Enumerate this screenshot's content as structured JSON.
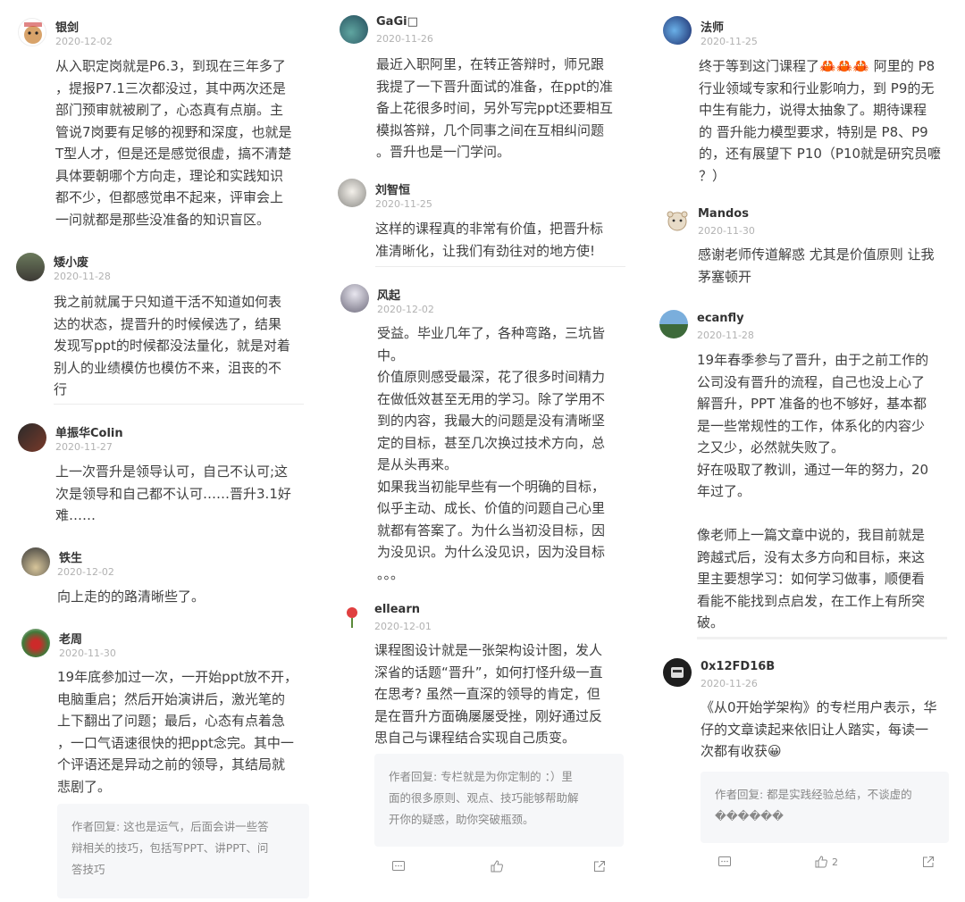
{
  "col1": [
    {
      "name": "银剑",
      "date": "2020-12-02",
      "text": "从入职定岗就是P6.3，到现在三年多了\n，提报P7.1三次都没过，其中两次还是\n部门预审就被刷了，心态真有点崩。主\n管说7岗要有足够的视野和深度，也就是\nT型人才，但是还是感觉很虚，搞不清楚\n具体要朝哪个方向走，理论和实践知识\n都不少，但都感觉串不起来，评审会上\n一问就都是那些没准备的知识盲区。"
    },
    {
      "name": "矮小废",
      "date": "2020-11-28",
      "text": "我之前就属于只知道干活不知道如何表\n达的状态，提晋升的时候候选了，结果\n发现写ppt的时候都没法量化，就是对着\n别人的业绩模仿也模仿不来，沮丧的不\n行"
    },
    {
      "name": "单振华Colin",
      "date": "2020-11-27",
      "text": "上一次晋升是领导认可，自己不认可;这\n次是领导和自己都不认可……晋升3.1好\n难……"
    },
    {
      "name": "铁生",
      "date": "2020-12-02",
      "text": "向上走的的路清晰些了。"
    },
    {
      "name": "老周",
      "date": "2020-11-30",
      "text": "19年底参加过一次，一开始ppt放不开，\n电脑重启；然后开始演讲后，激光笔的\n上下翻出了问题；最后，心态有点着急\n，一口气语速很快的把ppt念完。其中一\n个评语还是异动之前的领导，其结局就\n悲剧了。",
      "reply": "作者回复: 这也是运气，后面会讲一些答\n辩相关的技巧，包括写PPT、讲PPT、问\n答技巧"
    }
  ],
  "col2": [
    {
      "name": "GaGi□",
      "date": "2020-11-26",
      "text": "最近入职阿里，在转正答辩时，师兄跟\n我提了一下晋升面试的准备，在ppt的准\n备上花很多时间，另外写完ppt还要相互\n模拟答辩，几个同事之间在互相纠问题\n。晋升也是一门学问。"
    },
    {
      "name": "刘智恒",
      "date": "2020-11-25",
      "text": "这样的课程真的非常有价值，把晋升标\n准清晰化，让我们有劲往对的地方使!"
    },
    {
      "name": "风起",
      "date": "2020-12-02",
      "text": "受益。毕业几年了，各种弯路，三坑皆\n中。\n价值原则感受最深，花了很多时间精力\n在做低效甚至无用的学习。除了学用不\n到的内容，我最大的问题是没有清晰坚\n定的目标，甚至几次换过技术方向，总\n是从头再来。\n如果我当初能早些有一个明确的目标，\n似乎主动、成长、价值的问题自己心里\n就都有答案了。为什么当初没目标，因\n为没见识。为什么没见识，因为没目标\n。。。"
    },
    {
      "name": "ellearn",
      "date": "2020-12-01",
      "text": "课程图设计就是一张架构设计图，发人\n深省的话题“晋升”，如何打怪升级一直\n在思考? 虽然一直深的领导的肯定，但\n是在晋升方面确屡屡受挫，刚好通过反\n思自己与课程结合实现自己质变。",
      "reply": "作者回复: 专栏就是为你定制的 ：）里\n面的很多原则、观点、技巧能够帮助解\n开你的疑惑，助你突破瓶颈。"
    }
  ],
  "col3": [
    {
      "name": "法师",
      "date": "2020-11-25",
      "text": "终于等到这门课程了🦀🦀🦀 阿里的 P8\n行业领域专家和行业影响力，到 P9的无\n中生有能力，说得太抽象了。期待课程\n的 晋升能力模型要求，特别是 P8、P9\n的，还有展望下 P10（P10就是研究员嚒\n？）"
    },
    {
      "name": "Mandos",
      "date": "2020-11-30",
      "text": "感谢老师传道解惑 尤其是价值原则 让我\n茅塞顿开"
    },
    {
      "name": "ecanfly",
      "date": "2020-11-28",
      "text": "19年春季参与了晋升，由于之前工作的\n公司没有晋升的流程，自己也没上心了\n解晋升，PPT 准备的也不够好，基本都\n是一些常规性的工作，体系化的内容少\n之又少，必然就失败了。\n好在吸取了教训，通过一年的努力，20\n年过了。\n\n像老师上一篇文章中说的，我目前就是\n跨越式后，没有太多方向和目标，来这\n里主要想学习：如何学习做事，顺便看\n看能不能找到点启发，在工作上有所突\n破。"
    },
    {
      "name": "0x12FD16B",
      "date": "2020-11-26",
      "text": "《从0开始学架构》的专栏用户表示，华\n仔的文章读起来依旧让人踏实，每读一\n次都有收获😀",
      "reply": "作者回复: 都是实践经验总结，不谈虚的\n������"
    }
  ],
  "actions": {
    "like_count_col3": "2"
  }
}
